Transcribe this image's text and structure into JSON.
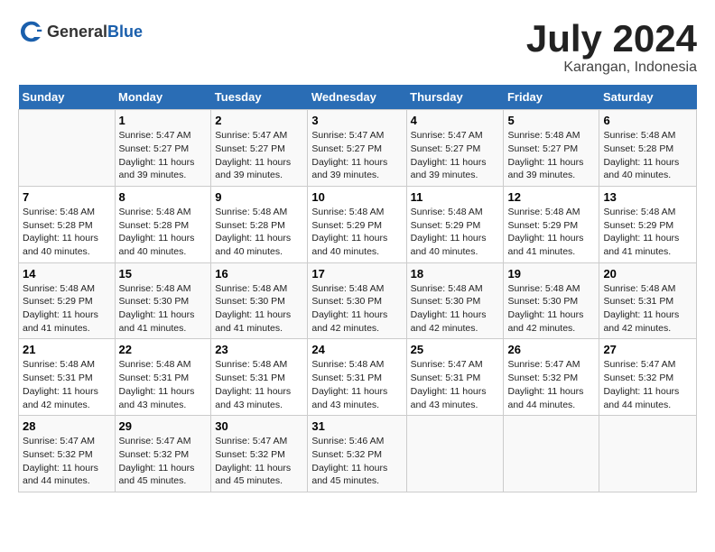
{
  "header": {
    "logo_general": "General",
    "logo_blue": "Blue",
    "title": "July 2024",
    "subtitle": "Karangan, Indonesia"
  },
  "calendar": {
    "days_of_week": [
      "Sunday",
      "Monday",
      "Tuesday",
      "Wednesday",
      "Thursday",
      "Friday",
      "Saturday"
    ],
    "weeks": [
      [
        {
          "day": "",
          "sunrise": "",
          "sunset": "",
          "daylight": ""
        },
        {
          "day": "1",
          "sunrise": "Sunrise: 5:47 AM",
          "sunset": "Sunset: 5:27 PM",
          "daylight": "Daylight: 11 hours and 39 minutes."
        },
        {
          "day": "2",
          "sunrise": "Sunrise: 5:47 AM",
          "sunset": "Sunset: 5:27 PM",
          "daylight": "Daylight: 11 hours and 39 minutes."
        },
        {
          "day": "3",
          "sunrise": "Sunrise: 5:47 AM",
          "sunset": "Sunset: 5:27 PM",
          "daylight": "Daylight: 11 hours and 39 minutes."
        },
        {
          "day": "4",
          "sunrise": "Sunrise: 5:47 AM",
          "sunset": "Sunset: 5:27 PM",
          "daylight": "Daylight: 11 hours and 39 minutes."
        },
        {
          "day": "5",
          "sunrise": "Sunrise: 5:48 AM",
          "sunset": "Sunset: 5:27 PM",
          "daylight": "Daylight: 11 hours and 39 minutes."
        },
        {
          "day": "6",
          "sunrise": "Sunrise: 5:48 AM",
          "sunset": "Sunset: 5:28 PM",
          "daylight": "Daylight: 11 hours and 40 minutes."
        }
      ],
      [
        {
          "day": "7",
          "sunrise": "Sunrise: 5:48 AM",
          "sunset": "Sunset: 5:28 PM",
          "daylight": "Daylight: 11 hours and 40 minutes."
        },
        {
          "day": "8",
          "sunrise": "Sunrise: 5:48 AM",
          "sunset": "Sunset: 5:28 PM",
          "daylight": "Daylight: 11 hours and 40 minutes."
        },
        {
          "day": "9",
          "sunrise": "Sunrise: 5:48 AM",
          "sunset": "Sunset: 5:28 PM",
          "daylight": "Daylight: 11 hours and 40 minutes."
        },
        {
          "day": "10",
          "sunrise": "Sunrise: 5:48 AM",
          "sunset": "Sunset: 5:29 PM",
          "daylight": "Daylight: 11 hours and 40 minutes."
        },
        {
          "day": "11",
          "sunrise": "Sunrise: 5:48 AM",
          "sunset": "Sunset: 5:29 PM",
          "daylight": "Daylight: 11 hours and 40 minutes."
        },
        {
          "day": "12",
          "sunrise": "Sunrise: 5:48 AM",
          "sunset": "Sunset: 5:29 PM",
          "daylight": "Daylight: 11 hours and 41 minutes."
        },
        {
          "day": "13",
          "sunrise": "Sunrise: 5:48 AM",
          "sunset": "Sunset: 5:29 PM",
          "daylight": "Daylight: 11 hours and 41 minutes."
        }
      ],
      [
        {
          "day": "14",
          "sunrise": "Sunrise: 5:48 AM",
          "sunset": "Sunset: 5:29 PM",
          "daylight": "Daylight: 11 hours and 41 minutes."
        },
        {
          "day": "15",
          "sunrise": "Sunrise: 5:48 AM",
          "sunset": "Sunset: 5:30 PM",
          "daylight": "Daylight: 11 hours and 41 minutes."
        },
        {
          "day": "16",
          "sunrise": "Sunrise: 5:48 AM",
          "sunset": "Sunset: 5:30 PM",
          "daylight": "Daylight: 11 hours and 41 minutes."
        },
        {
          "day": "17",
          "sunrise": "Sunrise: 5:48 AM",
          "sunset": "Sunset: 5:30 PM",
          "daylight": "Daylight: 11 hours and 42 minutes."
        },
        {
          "day": "18",
          "sunrise": "Sunrise: 5:48 AM",
          "sunset": "Sunset: 5:30 PM",
          "daylight": "Daylight: 11 hours and 42 minutes."
        },
        {
          "day": "19",
          "sunrise": "Sunrise: 5:48 AM",
          "sunset": "Sunset: 5:30 PM",
          "daylight": "Daylight: 11 hours and 42 minutes."
        },
        {
          "day": "20",
          "sunrise": "Sunrise: 5:48 AM",
          "sunset": "Sunset: 5:31 PM",
          "daylight": "Daylight: 11 hours and 42 minutes."
        }
      ],
      [
        {
          "day": "21",
          "sunrise": "Sunrise: 5:48 AM",
          "sunset": "Sunset: 5:31 PM",
          "daylight": "Daylight: 11 hours and 42 minutes."
        },
        {
          "day": "22",
          "sunrise": "Sunrise: 5:48 AM",
          "sunset": "Sunset: 5:31 PM",
          "daylight": "Daylight: 11 hours and 43 minutes."
        },
        {
          "day": "23",
          "sunrise": "Sunrise: 5:48 AM",
          "sunset": "Sunset: 5:31 PM",
          "daylight": "Daylight: 11 hours and 43 minutes."
        },
        {
          "day": "24",
          "sunrise": "Sunrise: 5:48 AM",
          "sunset": "Sunset: 5:31 PM",
          "daylight": "Daylight: 11 hours and 43 minutes."
        },
        {
          "day": "25",
          "sunrise": "Sunrise: 5:47 AM",
          "sunset": "Sunset: 5:31 PM",
          "daylight": "Daylight: 11 hours and 43 minutes."
        },
        {
          "day": "26",
          "sunrise": "Sunrise: 5:47 AM",
          "sunset": "Sunset: 5:32 PM",
          "daylight": "Daylight: 11 hours and 44 minutes."
        },
        {
          "day": "27",
          "sunrise": "Sunrise: 5:47 AM",
          "sunset": "Sunset: 5:32 PM",
          "daylight": "Daylight: 11 hours and 44 minutes."
        }
      ],
      [
        {
          "day": "28",
          "sunrise": "Sunrise: 5:47 AM",
          "sunset": "Sunset: 5:32 PM",
          "daylight": "Daylight: 11 hours and 44 minutes."
        },
        {
          "day": "29",
          "sunrise": "Sunrise: 5:47 AM",
          "sunset": "Sunset: 5:32 PM",
          "daylight": "Daylight: 11 hours and 45 minutes."
        },
        {
          "day": "30",
          "sunrise": "Sunrise: 5:47 AM",
          "sunset": "Sunset: 5:32 PM",
          "daylight": "Daylight: 11 hours and 45 minutes."
        },
        {
          "day": "31",
          "sunrise": "Sunrise: 5:46 AM",
          "sunset": "Sunset: 5:32 PM",
          "daylight": "Daylight: 11 hours and 45 minutes."
        },
        {
          "day": "",
          "sunrise": "",
          "sunset": "",
          "daylight": ""
        },
        {
          "day": "",
          "sunrise": "",
          "sunset": "",
          "daylight": ""
        },
        {
          "day": "",
          "sunrise": "",
          "sunset": "",
          "daylight": ""
        }
      ]
    ]
  }
}
